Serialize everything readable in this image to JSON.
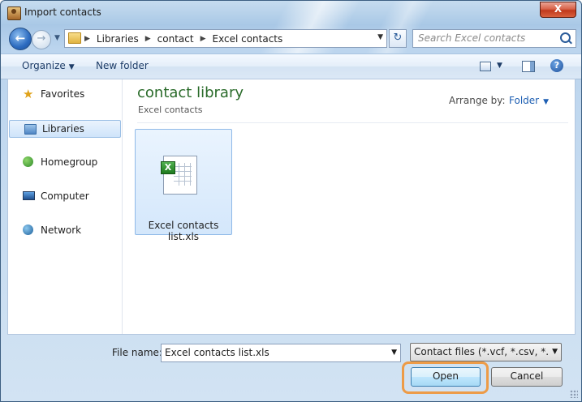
{
  "window": {
    "title": "Import contacts",
    "close_label": "X"
  },
  "nav": {
    "breadcrumbs": [
      "Libraries",
      "contact",
      "Excel contacts"
    ],
    "search_placeholder": "Search Excel contacts"
  },
  "toolbar": {
    "organize_label": "Organize",
    "new_folder_label": "New folder"
  },
  "sidebar": {
    "items": [
      {
        "label": "Favorites",
        "icon": "star-icon",
        "selected": false
      },
      {
        "label": "Libraries",
        "icon": "libraries-icon",
        "selected": true
      },
      {
        "label": "Homegroup",
        "icon": "homegroup-icon",
        "selected": false
      },
      {
        "label": "Computer",
        "icon": "computer-icon",
        "selected": false
      },
      {
        "label": "Network",
        "icon": "network-icon",
        "selected": false
      }
    ]
  },
  "main": {
    "library_title": "contact library",
    "library_subtitle": "Excel contacts",
    "arrange_label": "Arrange by:",
    "arrange_value": "Folder",
    "files": [
      {
        "name": "Excel contacts list.xls",
        "icon": "excel-file-icon",
        "selected": true
      }
    ]
  },
  "footer": {
    "file_name_label": "File name:",
    "file_name_value": "Excel contacts list.xls",
    "file_type_value": "Contact files (*.vcf, *.csv, *.xls, *",
    "open_label": "Open",
    "cancel_label": "Cancel",
    "highlight_color": "#ed9b47"
  }
}
